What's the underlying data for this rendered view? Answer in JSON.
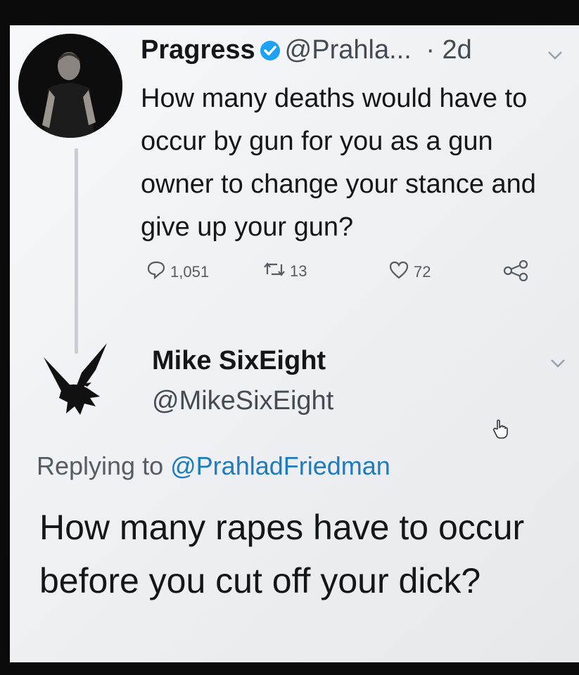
{
  "original_tweet": {
    "display_name": "Pragress",
    "handle": "@Prahla...",
    "time": "· 2d",
    "text": "How many deaths would have to occur by gun for you as a gun owner to change your stance and give up your gun?",
    "replies_count": "1,051",
    "retweets_count": "13",
    "likes_count": "72",
    "icons": {
      "verified": "verified-badge-icon",
      "reply": "reply-icon",
      "retweet": "retweet-icon",
      "like": "heart-icon",
      "share": "share-icon",
      "menu": "chevron-down-icon"
    },
    "colors": {
      "verified": "#1da1f2",
      "mention": "#1b7cc0"
    }
  },
  "reply_tweet": {
    "display_name": "Mike SixEight",
    "handle": "@MikeSixEight",
    "replying_prefix": "Replying to",
    "replying_to": "@PrahladFriedman",
    "text": "How many rapes have to occur before you cut off your dick?"
  }
}
